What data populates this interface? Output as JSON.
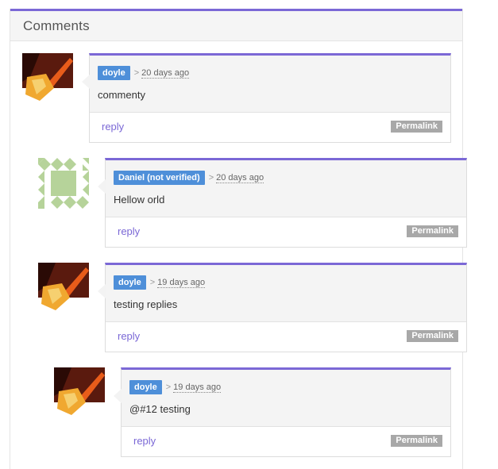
{
  "header": {
    "title": "Comments"
  },
  "comments": [
    {
      "author": "doyle",
      "separator": ">",
      "time": "20 days ago",
      "body": "commenty",
      "reply_label": "reply",
      "permalink_label": "Permalink",
      "avatar": "guitar-avatar"
    },
    {
      "author": "Daniel (not verified)",
      "separator": ">",
      "time": "20 days ago",
      "body": "Hellow orld",
      "reply_label": "reply",
      "permalink_label": "Permalink",
      "avatar": "identicon-avatar"
    },
    {
      "author": "doyle",
      "separator": ">",
      "time": "19 days ago",
      "body": "testing replies",
      "reply_label": "reply",
      "permalink_label": "Permalink",
      "avatar": "guitar-avatar"
    },
    {
      "author": "doyle",
      "separator": ">",
      "time": "19 days ago",
      "body": "@#12 testing",
      "reply_label": "reply",
      "permalink_label": "Permalink",
      "avatar": "guitar-avatar"
    }
  ],
  "colors": {
    "accent": "#7b68d6",
    "author_badge": "#4e8fd9",
    "permalink_badge": "#a8a8a8"
  }
}
